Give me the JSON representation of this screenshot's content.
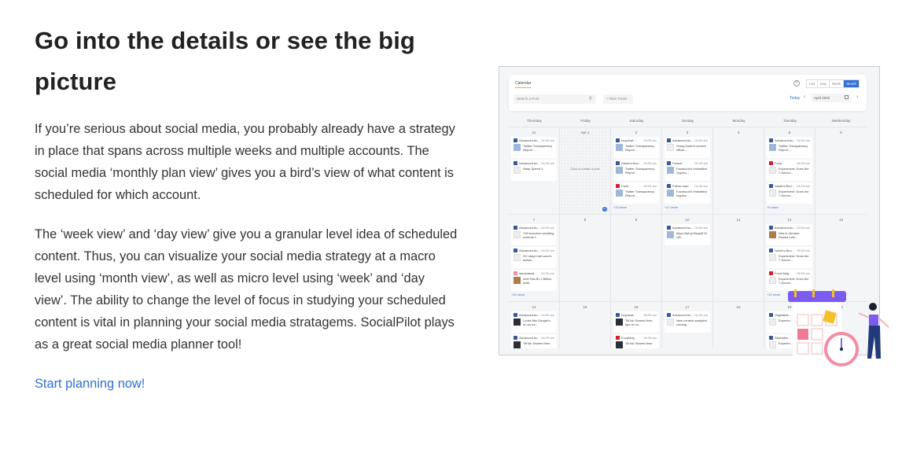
{
  "section": {
    "heading": "Go into the details or see the big picture",
    "paragraphs": [
      "If you’re serious about social media, you probably already have a strategy in place that spans across multiple weeks and multiple accounts. The social media ‘monthly plan view’ gives you a bird’s view of what content is scheduled for which account.",
      "The ‘week view’ and ‘day view’ give you a granular level idea of scheduled content. Thus, you can visualize your social media strategy at a macro level using ‘month view’, as well as micro level using ‘week’ and ‘day view’. The ability to change the level of focus in studying your scheduled content is vital in planning your social media stratagems. SocialPilot plays as a great social media planner tool!"
    ],
    "cta_label": "Start planning now!",
    "link_color": "#2f6fd8"
  },
  "calendar_app": {
    "tab_label": "Calendar",
    "search_placeholder": "Search a Post",
    "filter_label": "Filter Posts",
    "help_label": "?",
    "views": [
      "List",
      "Day",
      "Week",
      "Month"
    ],
    "active_view": "Month",
    "today_label": "Today",
    "month_value": "April 2022",
    "weekdays": [
      "Thursday",
      "Friday",
      "Saturday",
      "Sunday",
      "Monday",
      "Tuesday",
      "Wednesday"
    ],
    "click_to_create": "Click to create a post",
    "weeks": [
      {
        "days": [
          {
            "num": "31",
            "posts": [
              {
                "account": "Advanced Ac...",
                "time": "04:00 am",
                "text": "Twitter Transparency Report ...",
                "icon": "facebook",
                "thumb": "blue"
              },
              {
                "account": "Advanced Ac...",
                "time": "04:30 am",
                "text": "Warp Speed 2",
                "icon": "facebook",
                "thumb": "light"
              }
            ],
            "more": ""
          },
          {
            "num": "Apr 1",
            "posts": [],
            "more": "",
            "empty": true
          },
          {
            "num": "2",
            "posts": [
              {
                "account": "fooprivat...",
                "time": "09:25 am",
                "text": "Twitter Transparency Report ...",
                "icon": "facebook",
                "thumb": "blue"
              },
              {
                "account": "Sarah's Bou...",
                "time": "09:25 am",
                "text": "Twitter Transparency Report ...",
                "icon": "facebook",
                "thumb": "blue"
              },
              {
                "account": "Food",
                "time": "09:25 am",
                "text": "Twitter Transparency Report ...",
                "icon": "pinterest",
                "thumb": "blue"
              }
            ],
            "more": "+13 more"
          },
          {
            "num": "3",
            "posts": [
              {
                "account": "Advanced Ac...",
                "time": "04:30 am",
                "text": "Smog tower's current efficie...",
                "icon": "facebook",
                "thumb": "light"
              },
              {
                "account": "Farmer",
                "time": "04:30 am",
                "text": "Facebook's embattled cryptoc...",
                "icon": "facebook",
                "thumb": "blue"
              },
              {
                "account": "Follow man",
                "time": "04:30 am",
                "text": "Facebook's embattled cryptoc...",
                "icon": "facebook",
                "thumb": "blue"
              }
            ],
            "more": "+17 more"
          },
          {
            "num": "4",
            "posts": [],
            "more": ""
          },
          {
            "num": "5",
            "posts": [
              {
                "account": "Advanced Ac...",
                "time": "04:00 am",
                "text": "Twitter Transparency Report ...",
                "icon": "facebook",
                "thumb": "blue"
              },
              {
                "account": "Food",
                "time": "05:25 am",
                "text": "Experiment: Does the 7-Secon...",
                "icon": "pinterest",
                "thumb": "light"
              },
              {
                "account": "Sarah's Bou...",
                "time": "05:25 am",
                "text": "Experiment: Does the 7-Secon...",
                "icon": "facebook",
                "thumb": "light"
              }
            ],
            "more": "+6 more"
          },
          {
            "num": "6",
            "posts": [],
            "more": ""
          }
        ]
      },
      {
        "days": [
          {
            "num": "7",
            "posts": [
              {
                "account": "Advanced Ac...",
                "time": "04:00 am",
                "text": "CM launches wedding scheme f...",
                "icon": "facebook",
                "thumb": "light"
              },
              {
                "account": "Advanced Ac...",
                "time": "04:30 am",
                "text": "HC stays trial court's defam...",
                "icon": "facebook",
                "thumb": "light"
              },
              {
                "account": "stevedavid...",
                "time": "04:25 pm",
                "text": "Intel Has $1.2 Billion Antit...",
                "icon": "instagram",
                "thumb": "brown"
              }
            ],
            "more": "+12 more"
          },
          {
            "num": "8",
            "posts": [],
            "more": ""
          },
          {
            "num": "9",
            "posts": [],
            "more": ""
          },
          {
            "num": "10",
            "posts": [
              {
                "account": "Advanced Ac...",
                "time": "04:30 am",
                "text": "https://bit.ly/3bwpM M UR...",
                "icon": "facebook",
                "thumb": "blue"
              }
            ],
            "more": ""
          },
          {
            "num": "11",
            "posts": [],
            "more": ""
          },
          {
            "num": "12",
            "posts": [
              {
                "account": "Advanced Ac...",
                "time": "04:00 am",
                "text": "War in Ukraine: Russia exte...",
                "icon": "facebook",
                "thumb": "brown"
              },
              {
                "account": "Sarah's Bou...",
                "time": "09:25 am",
                "text": "Experiment: Does the 7-Secon...",
                "icon": "facebook",
                "thumb": "light"
              },
              {
                "account": "Food Blog",
                "time": "09:25 am",
                "text": "Experiment: Does the 7-Secon...",
                "icon": "pinterest",
                "thumb": "light"
              }
            ],
            "more": "+12 more"
          },
          {
            "num": "13",
            "posts": [],
            "more": ""
          }
        ]
      },
      {
        "days": [
          {
            "num": "14",
            "posts": [
              {
                "account": "Advanced Ac...",
                "time": "04:00 am",
                "text": "Looks like Google's on an ea...",
                "icon": "facebook",
                "thumb": "dark"
              },
              {
                "account": "Advanced Ac...",
                "time": "04:30 am",
                "text": "TikTok Shares New",
                "icon": "facebook",
                "thumb": "dark"
              }
            ],
            "more": ""
          },
          {
            "num": "15",
            "posts": [],
            "more": ""
          },
          {
            "num": "16",
            "posts": [
              {
                "account": "fooprivat...",
                "time": "09:30 am",
                "text": "TikTok Shares New tips on co...",
                "icon": "facebook",
                "thumb": "dark"
              },
              {
                "account": "Foodblog",
                "time": "09:30 am",
                "text": "TikTok Shares New",
                "icon": "pinterest",
                "thumb": "dark"
              }
            ],
            "more": ""
          },
          {
            "num": "17",
            "posts": [
              {
                "account": "Advanced Ac...",
                "time": "04:30 am",
                "text": "New content analytics coming...",
                "icon": "facebook",
                "thumb": "light"
              }
            ],
            "more": ""
          },
          {
            "num": "18",
            "posts": [],
            "more": ""
          },
          {
            "num": "19",
            "posts": [
              {
                "account": "Vegetable...",
                "time": "",
                "text": "Experim...",
                "icon": "facebook",
                "thumb": "light"
              },
              {
                "account": "Skywalke...",
                "time": "",
                "text": "Experim...",
                "icon": "facebook",
                "thumb": "light"
              }
            ],
            "more": ""
          },
          {
            "num": "20",
            "posts": [],
            "more": ""
          }
        ]
      }
    ]
  }
}
